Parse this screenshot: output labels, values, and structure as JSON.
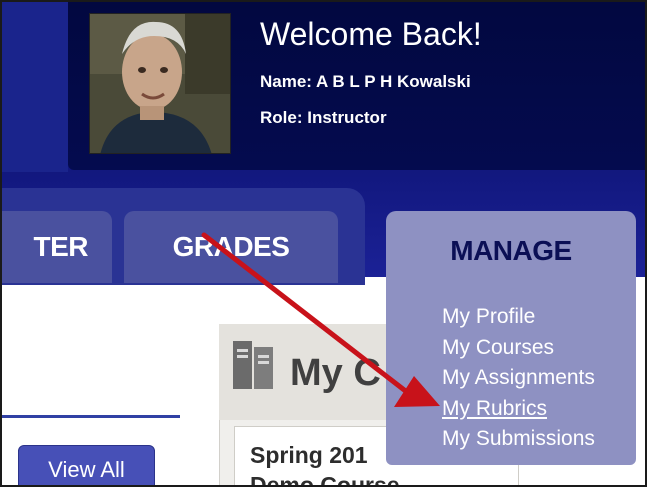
{
  "header": {
    "welcome": "Welcome Back!",
    "name_line": "Name: A B L P H Kowalski",
    "role_line": "Role: Instructor"
  },
  "tabs": [
    {
      "label": "TER"
    },
    {
      "label": "GRADES"
    },
    {
      "label": "MANAGE",
      "active": true
    }
  ],
  "manage_menu": {
    "items": [
      {
        "label": "My Profile"
      },
      {
        "label": "My Courses"
      },
      {
        "label": "My Assignments"
      },
      {
        "label": "My Rubrics",
        "highlighted": true
      },
      {
        "label": "My Submissions"
      }
    ]
  },
  "content": {
    "view_all_label": "View All",
    "courses_title": "My C",
    "course_term": "Spring 201",
    "course_name": "Demo Course"
  },
  "icons": {
    "courses": "books-icon"
  },
  "colors": {
    "header_dark": "#040b4f",
    "tab": "#4a519f",
    "manage_tab": "#8e91c2",
    "arrow": "#c8121a"
  }
}
